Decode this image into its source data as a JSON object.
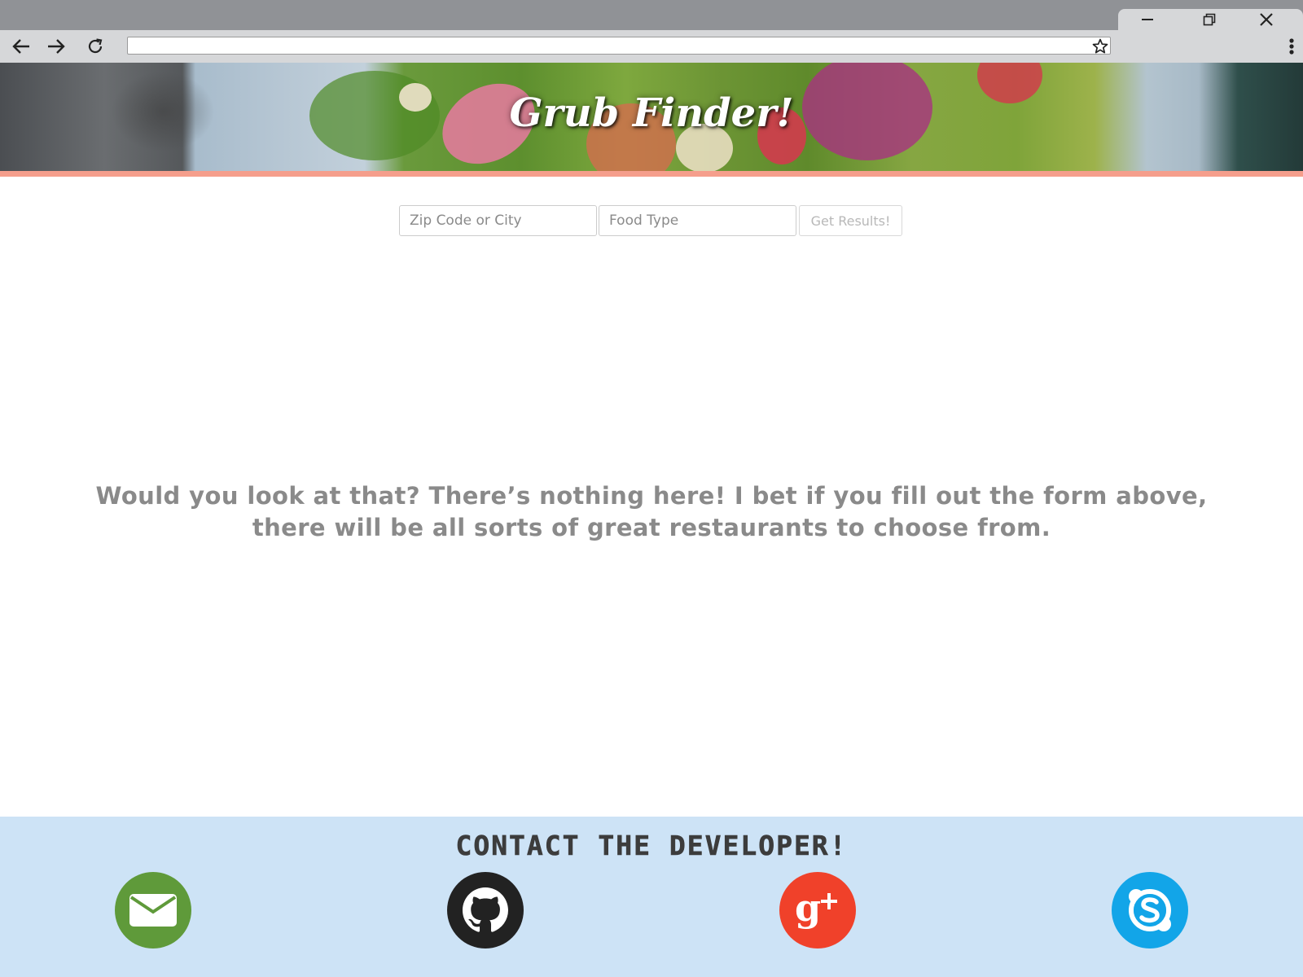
{
  "browser": {
    "url": "",
    "window_controls": [
      "minimize-icon",
      "restore-icon",
      "close-icon"
    ],
    "nav": [
      "back-arrow-icon",
      "forward-arrow-icon",
      "reload-icon"
    ],
    "bookmark_icon": "star-icon",
    "menu_icon": "kebab-menu-icon"
  },
  "hero": {
    "title": "Grub Finder!",
    "accent_color": "#f59e8c"
  },
  "search": {
    "location_placeholder": "Zip Code or City",
    "food_placeholder": "Food Type",
    "submit_label": "Get Results!"
  },
  "main": {
    "empty_line1": "Would you look at that? There’s nothing here! I bet if you fill out the form above,",
    "empty_line2": "there will be all sorts of great restaurants to choose from."
  },
  "footer": {
    "heading": "CONTACT THE DEVELOPER!",
    "background": "#cde3f6",
    "contacts": [
      {
        "icon": "email-icon",
        "color": "#5f9a3a"
      },
      {
        "icon": "github-icon",
        "color": "#222222"
      },
      {
        "icon": "google-plus-icon",
        "color": "#f0412a"
      },
      {
        "icon": "skype-icon",
        "color": "#12a5e8"
      }
    ]
  }
}
